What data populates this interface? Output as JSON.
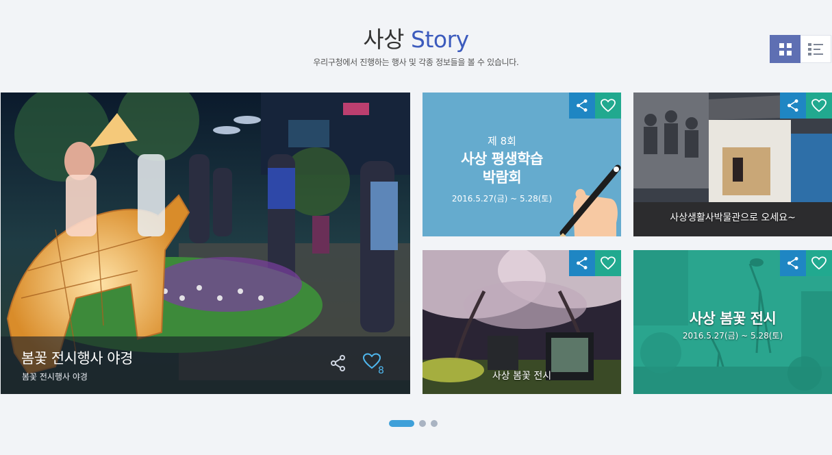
{
  "header": {
    "title_main": "사상",
    "title_accent": "Story",
    "subtitle": "우리구청에서 진행하는 행사 및 각종 정보들을 볼 수 있습니다."
  },
  "view_toggle": {
    "active": "grid",
    "icons": [
      "grid-view-icon",
      "list-view-icon"
    ]
  },
  "featured": {
    "title": "봄꽃 전시행사 야경",
    "subtitle": "봄꽃 전시행사 야경",
    "like_count": "8"
  },
  "cards": {
    "c1": {
      "line1": "제 8회",
      "line2a": "사상 평생학습",
      "line2b": "박람회",
      "date": "2016.5.27(금) ~ 5.28(토)"
    },
    "c2": {
      "caption": "사상생활사박물관으로 오세요~"
    },
    "c3": {
      "caption": "사상 봄꽃 전시"
    },
    "c4": {
      "title": "사상 봄꽃 전시",
      "date": "2016.5.27(금) ~ 5.28(토)"
    }
  },
  "pagination": {
    "pages": 3,
    "current": 1
  },
  "colors": {
    "accent": "#3c5bbd",
    "share": "#1f86c3",
    "like": "#21a98f",
    "card_blue": "#65abce",
    "card_teal": "#2aa58e",
    "active_dot": "#3fa0d9"
  }
}
